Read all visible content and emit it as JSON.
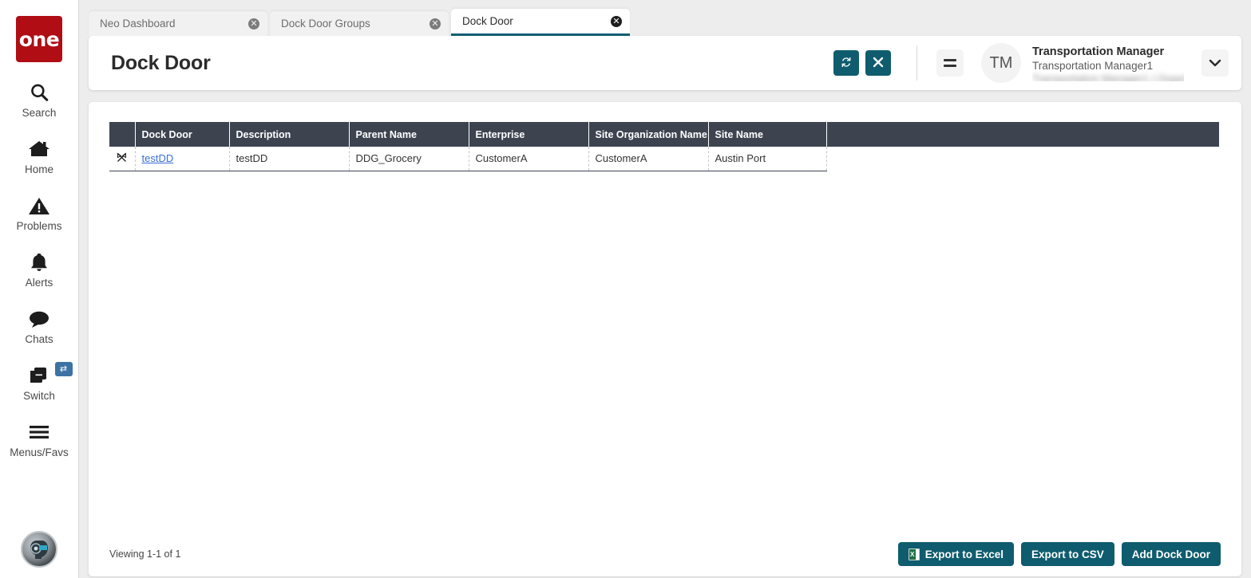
{
  "sidebar": {
    "logo_text": "one",
    "items": [
      {
        "label": "Search",
        "icon": "search-icon"
      },
      {
        "label": "Home",
        "icon": "home-icon"
      },
      {
        "label": "Problems",
        "icon": "warning-triangle-icon"
      },
      {
        "label": "Alerts",
        "icon": "bell-icon"
      },
      {
        "label": "Chats",
        "icon": "chat-bubble-icon"
      },
      {
        "label": "Switch",
        "icon": "windows-stack-icon",
        "badge_icon": "swap-arrows-icon"
      },
      {
        "label": "Menus/Favs",
        "icon": "hamburger-icon"
      }
    ],
    "bottom_avatar_icon": "ai-assistant-avatar-icon"
  },
  "tabs": [
    {
      "label": "Neo Dashboard",
      "active": false
    },
    {
      "label": "Dock Door Groups",
      "active": false
    },
    {
      "label": "Dock Door",
      "active": true
    }
  ],
  "header": {
    "title": "Dock Door",
    "refresh_icon": "refresh-icon",
    "close_icon": "close-x-icon",
    "menu_icon": "list-menu-icon",
    "avatar_initials": "TM",
    "user_name": "Transportation Manager",
    "user_role": "Transportation Manager1",
    "user_org": "Transportation Manager1 | Organization",
    "caret_icon": "chevron-down-icon"
  },
  "grid": {
    "columns": [
      "Dock Door",
      "Description",
      "Parent Name",
      "Enterprise",
      "Site Organization Name",
      "Site Name"
    ],
    "rows": [
      {
        "handle_icon": "drag-handle-icon",
        "dock_door": "testDD",
        "description": "testDD",
        "parent_name": "DDG_Grocery",
        "enterprise": "CustomerA",
        "site_organization_name": "CustomerA",
        "site_name": "Austin Port"
      }
    ]
  },
  "footer": {
    "viewing": "Viewing 1-1 of 1",
    "export_excel_label": "Export to Excel",
    "export_excel_icon": "excel-file-icon",
    "export_csv_label": "Export to CSV",
    "add_dock_door_label": "Add Dock Door"
  },
  "colors": {
    "brand_red": "#b00d14",
    "teal": "#0f5c6e",
    "grid_header": "#3d4450",
    "link_blue": "#3b6fd4",
    "page_bg": "#ededed"
  }
}
